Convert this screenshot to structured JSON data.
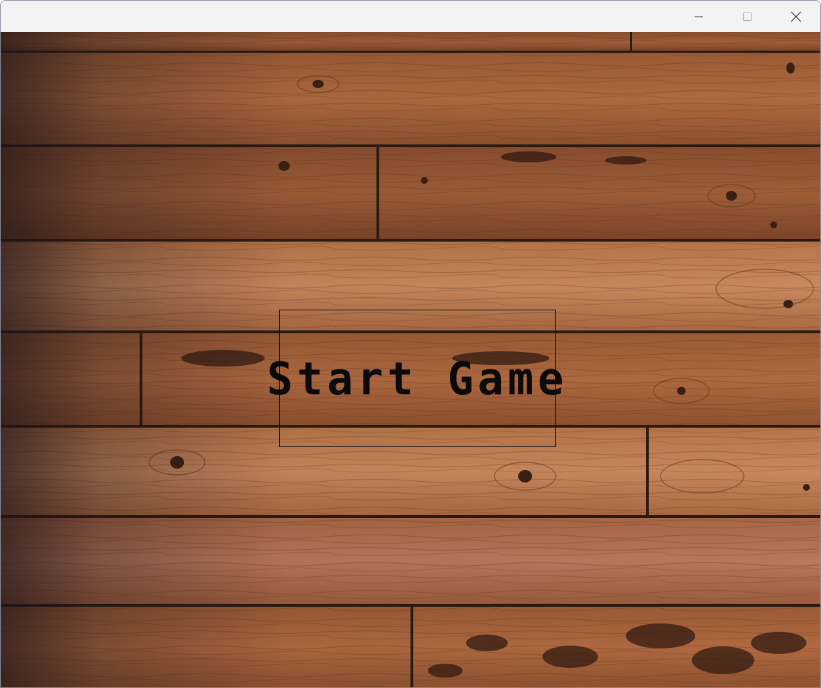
{
  "window": {
    "controls": {
      "minimize_icon": "minimize-icon",
      "maximize_icon": "maximize-icon",
      "close_icon": "close-icon"
    }
  },
  "game": {
    "background": "wood-plank-floor",
    "start_button": {
      "label": "Start Game"
    }
  },
  "colors": {
    "wood_light": "#c8855a",
    "wood_mid": "#a5603a",
    "wood_dark": "#5a3320",
    "gap": "#2b1a12",
    "text": "#0a0a0a"
  }
}
